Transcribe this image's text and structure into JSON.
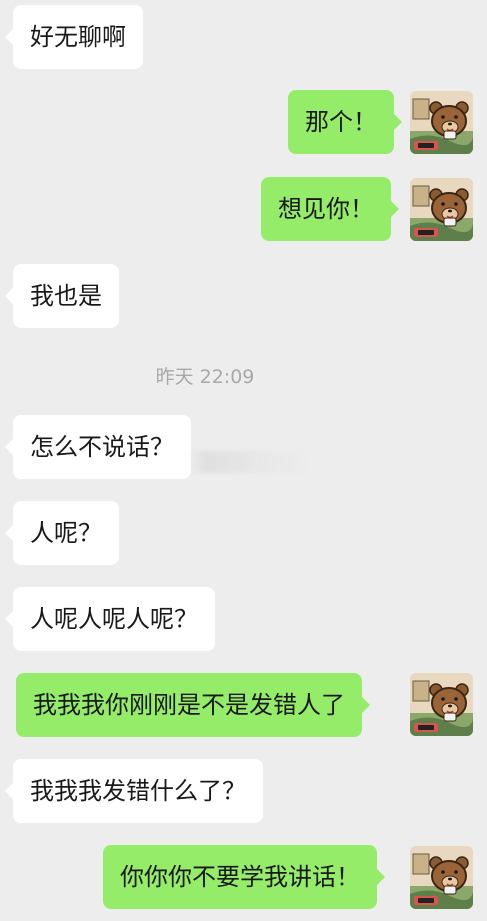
{
  "chat": {
    "messages": [
      {
        "side": "incoming",
        "text": "好无聊啊"
      },
      {
        "side": "outgoing",
        "text": "那个！"
      },
      {
        "side": "outgoing",
        "text": "想见你！"
      },
      {
        "side": "incoming",
        "text": "我也是"
      },
      {
        "side": "incoming",
        "text": "怎么不说话？"
      },
      {
        "side": "incoming",
        "text": "人呢？"
      },
      {
        "side": "incoming",
        "text": "人呢人呢人呢？"
      },
      {
        "side": "outgoing",
        "text": "我我我你刚刚是不是发错人了"
      },
      {
        "side": "incoming",
        "text": "我我我发错什么了？"
      },
      {
        "side": "outgoing",
        "text": "你你你不要学我讲话！"
      }
    ],
    "timestamp": "昨天 22:09"
  },
  "colors": {
    "background": "#ededed",
    "incoming_bubble": "#ffffff",
    "outgoing_bubble": "#95ec69",
    "text": "#191919",
    "timestamp": "#a8a8a8"
  },
  "avatar": {
    "icon": "brown-bear-sticker-avatar"
  }
}
